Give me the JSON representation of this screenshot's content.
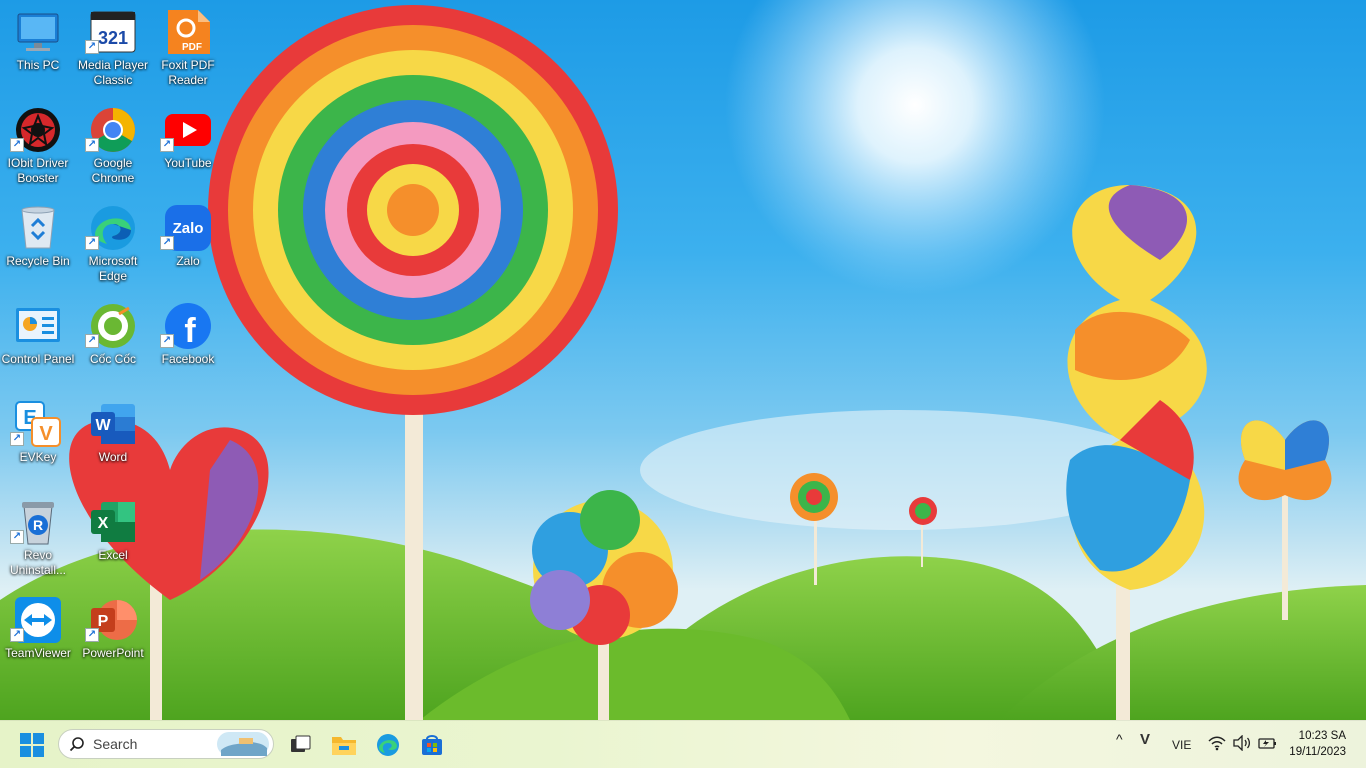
{
  "desktop": {
    "icons": [
      {
        "label": "This PC",
        "icon": "monitor-icon"
      },
      {
        "label": "Media Player Classic",
        "icon": "media-player-icon"
      },
      {
        "label": "Foxit PDF Reader",
        "icon": "pdf-icon"
      },
      {
        "label": "IObit Driver Booster",
        "icon": "driver-booster-icon"
      },
      {
        "label": "Google Chrome",
        "icon": "chrome-icon"
      },
      {
        "label": "YouTube",
        "icon": "youtube-icon"
      },
      {
        "label": "Recycle Bin",
        "icon": "recycle-bin-icon"
      },
      {
        "label": "Microsoft Edge",
        "icon": "edge-icon"
      },
      {
        "label": "Zalo",
        "icon": "zalo-icon"
      },
      {
        "label": "Control Panel",
        "icon": "control-panel-icon"
      },
      {
        "label": "Cốc Cốc",
        "icon": "coccoc-icon"
      },
      {
        "label": "Facebook",
        "icon": "facebook-icon"
      },
      {
        "label": "EVKey",
        "icon": "evkey-icon"
      },
      {
        "label": "Word",
        "icon": "word-icon"
      },
      {
        "label": "Revo Uninstall...",
        "icon": "revo-icon"
      },
      {
        "label": "Excel",
        "icon": "excel-icon"
      },
      {
        "label": "TeamViewer",
        "icon": "teamviewer-icon"
      },
      {
        "label": "PowerPoint",
        "icon": "powerpoint-icon"
      }
    ],
    "icon_text": {
      "media_player": "321",
      "pdf": "PDF",
      "zalo": "Zalo",
      "facebook": "f",
      "word": "W",
      "excel": "X",
      "powerpoint": "P",
      "evkey_e": "E",
      "evkey_v": "V",
      "revo": "R",
      "shortcut_arrow": "↗"
    }
  },
  "taskbar": {
    "search_placeholder": "Search",
    "apps": [
      "start-icon",
      "task-view-icon",
      "file-explorer-icon",
      "edge-icon",
      "store-icon"
    ],
    "tray": {
      "chevron": "^",
      "evkey": "V",
      "language": "VIE",
      "wifi": "wifi-icon",
      "volume": "volume-icon",
      "battery": "battery-icon"
    },
    "clock": {
      "time": "10:23 SA",
      "date": "19/11/2023"
    }
  },
  "colors": {
    "sky": "#2ea6ea",
    "grass": "#74c335",
    "taskbar": "#eaf5d0"
  }
}
